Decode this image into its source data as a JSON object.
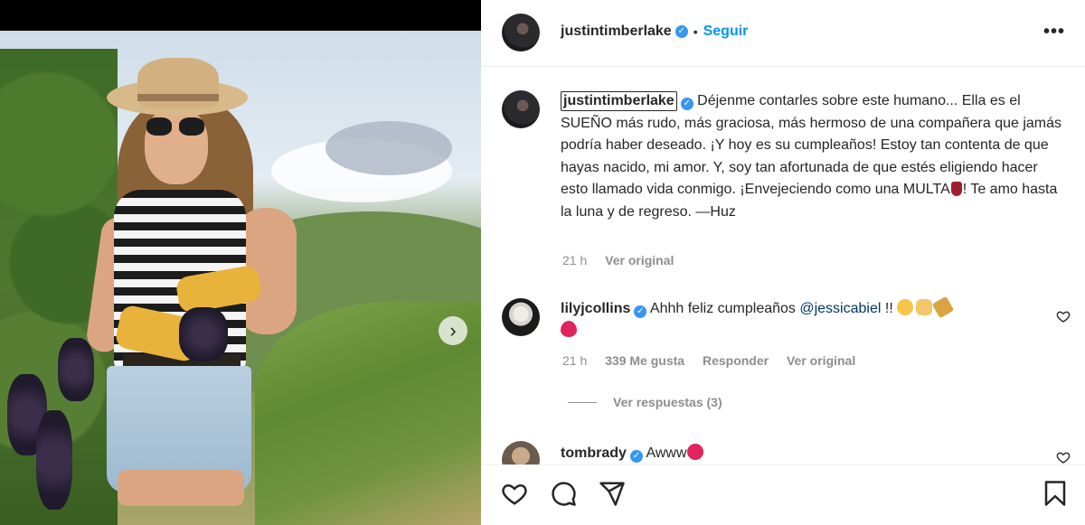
{
  "post": {
    "username": "justintimberlake",
    "follow_label": "Seguir",
    "separator": "•",
    "more_label": "•••",
    "verified_mark": "✓"
  },
  "caption": {
    "username": "justintimberlake",
    "text": "Déjenme contarles sobre este humano... Ella es el SUEÑO más rudo, más graciosa, más hermoso de una compañera que jamás podría haber deseado. ¡Y hoy es su cumpleaños! Estoy tan contenta de que hayas nacido, mi amor. Y, soy tan afortunada de que estés eligiendo hacer esto llamado vida conmigo. ¡Envejeciendo como una MULTA",
    "text_end": "! Te amo hasta la luna y de regreso. —Huz",
    "time": "21 h",
    "see_original": "Ver original"
  },
  "comments": [
    {
      "username": "lilyjcollins",
      "text": "Ahhh feliz cumpleaños",
      "mention": "@jessicabiel",
      "suffix": "!!",
      "time": "21 h",
      "likes": "339 Me gusta",
      "reply": "Responder",
      "see_original": "Ver original",
      "view_replies": "Ver respuestas (3)"
    },
    {
      "username": "tombrady",
      "text": "Awww"
    }
  ],
  "photo": {
    "next_arrow": "›"
  },
  "icons": {
    "like": "heart-icon",
    "comment": "comment-icon",
    "share": "share-icon",
    "save": "bookmark-icon",
    "more": "more-options-icon"
  },
  "colors": {
    "link_blue": "#0095f6",
    "verified_blue": "#3797f0",
    "muted_gray": "#8e8e8e",
    "text": "#262626"
  }
}
